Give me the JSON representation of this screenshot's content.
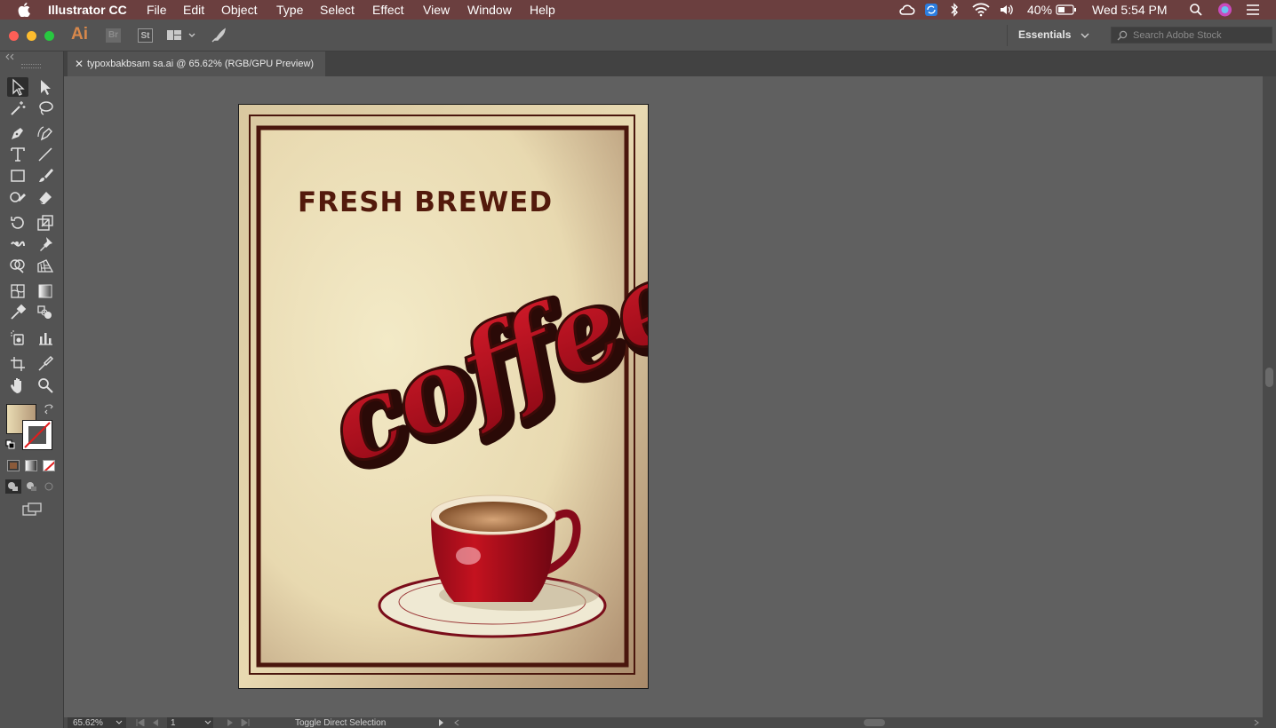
{
  "menubar": {
    "app_name": "Illustrator CC",
    "menus": [
      "File",
      "Edit",
      "Object",
      "Type",
      "Select",
      "Effect",
      "View",
      "Window",
      "Help"
    ],
    "battery": "40%",
    "clock": "Wed 5:54 PM"
  },
  "appbar": {
    "logo": "Ai",
    "bridge": "Br",
    "stock": "St",
    "workspace": "Essentials",
    "search_placeholder": "Search Adobe Stock"
  },
  "document_tab": {
    "title": "typoxbakbsam sa.ai @ 65.62% (RGB/GPU Preview)"
  },
  "artwork": {
    "headline": "FRESH BREWED",
    "script_word": "coffee",
    "colors": {
      "frame": "#4a160d",
      "coffee_red": "#a30d1f",
      "paper": "#eee3bd"
    }
  },
  "status": {
    "zoom": "65.62%",
    "artboard_number": "1",
    "mode": "Toggle Direct Selection"
  },
  "toolbar": {
    "tools": [
      "selection-tool",
      "direct-selection-tool",
      "magic-wand-tool",
      "lasso-tool",
      "pen-tool",
      "curvature-tool",
      "type-tool",
      "line-tool",
      "rectangle-tool",
      "paintbrush-tool",
      "shaper-tool",
      "eraser-tool",
      "rotate-tool",
      "scale-tool",
      "warp-tool",
      "puppet-warp-tool",
      "shape-builder-tool",
      "perspective-grid-tool",
      "mesh-tool",
      "gradient-tool",
      "eyedropper-tool",
      "blend-tool",
      "symbol-sprayer-tool",
      "column-graph-tool",
      "artboard-tool",
      "slice-tool",
      "hand-tool",
      "zoom-tool"
    ]
  }
}
